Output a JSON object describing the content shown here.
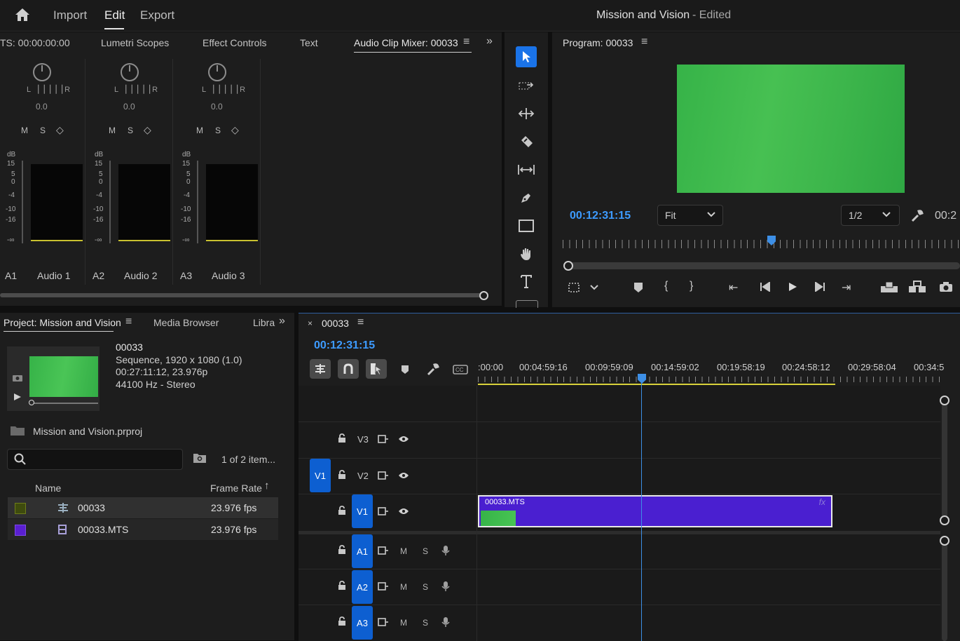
{
  "topbar": {
    "import": "Import",
    "edit": "Edit",
    "export": "Export",
    "title": "Mission and Vision",
    "edited": "- Edited"
  },
  "source_panel": {
    "tabs": [
      "TS: 00:00:00:00",
      "Lumetri Scopes",
      "Effect Controls",
      "Text",
      "Audio Clip Mixer: 00033"
    ],
    "channels": [
      {
        "id": "A1",
        "name": "Audio 1",
        "pan_label": "L ▕▕▕▕▕ R",
        "pan_value": "0.0"
      },
      {
        "id": "A2",
        "name": "Audio 2",
        "pan_label": "L ▕▕▕▕▕ R",
        "pan_value": "0.0"
      },
      {
        "id": "A3",
        "name": "Audio 3",
        "pan_label": "L ▕▕▕▕▕ R",
        "pan_value": "0.0"
      }
    ],
    "msd": [
      "M",
      "S",
      "◇"
    ],
    "db_label": "dB",
    "db_scale": [
      "15",
      "5",
      "0",
      "-4",
      "-10",
      "-16",
      "-∞"
    ]
  },
  "program": {
    "title": "Program: 00033",
    "timecode": "00:12:31:15",
    "fit": "Fit",
    "resolution": "1/2",
    "right_timecode": "00:2",
    "video_color": "#3fb94f"
  },
  "project": {
    "tabs": [
      "Project: Mission and Vision",
      "Media Browser",
      "Libra"
    ],
    "seq_name": "00033",
    "seq_line1": "Sequence, 1920 x 1080 (1.0)",
    "seq_line2": "00:27:11:12, 23.976p",
    "seq_line3": "44100 Hz - Stereo",
    "proj_file": "Mission and Vision.prproj",
    "item_count": "1 of 2 item...",
    "col_name": "Name",
    "col_rate": "Frame Rate",
    "rows": [
      {
        "name": "00033",
        "rate": "23.976 fps",
        "swatch": "#3e4b0e"
      },
      {
        "name": "00033.MTS",
        "rate": "23.976 fps",
        "swatch": "#5a1fd1"
      }
    ]
  },
  "timeline": {
    "tab": "00033",
    "timecode": "00:12:31:15",
    "ruler": [
      ":00:00",
      "00:04:59:16",
      "00:09:59:09",
      "00:14:59:02",
      "00:19:58:19",
      "00:24:58:12",
      "00:29:58:04",
      "00:34:5"
    ],
    "tracks": [
      "V3",
      "V2",
      "V1",
      "A1",
      "A2",
      "A3"
    ],
    "source_patch": "V1",
    "clip_name": "00033.MTS",
    "clip_fx": "fx",
    "clip_color": "#4a1fd0",
    "msd_m": "M",
    "msd_s": "S"
  }
}
